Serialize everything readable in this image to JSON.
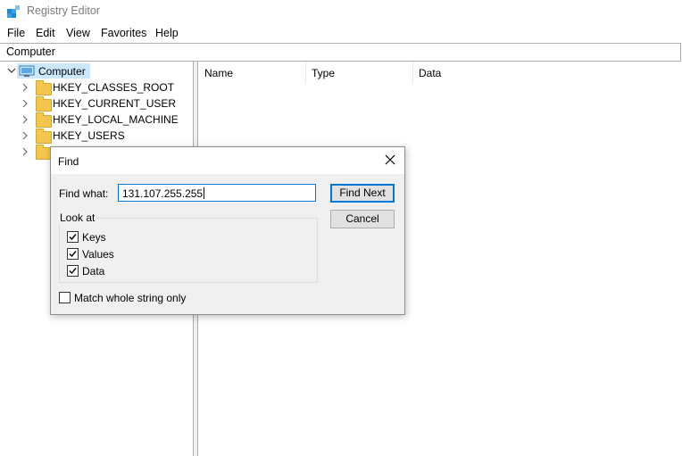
{
  "window": {
    "title": "Registry Editor"
  },
  "menu": [
    "File",
    "Edit",
    "View",
    "Favorites",
    "Help"
  ],
  "address": "Computer",
  "tree": {
    "root": "Computer",
    "keys": [
      "HKEY_CLASSES_ROOT",
      "HKEY_CURRENT_USER",
      "HKEY_LOCAL_MACHINE",
      "HKEY_USERS",
      ""
    ]
  },
  "columns": [
    "Name",
    "Type",
    "Data"
  ],
  "find_dialog": {
    "title": "Find",
    "find_what_label": "Find what:",
    "find_what_value": "131.107.255.255",
    "find_next_label": "Find Next",
    "cancel_label": "Cancel",
    "look_at_label": "Look at",
    "options": [
      {
        "label": "Keys",
        "checked": true
      },
      {
        "label": "Values",
        "checked": true
      },
      {
        "label": "Data",
        "checked": true
      }
    ],
    "match_whole_label": "Match whole string only",
    "match_whole_checked": false
  },
  "colors": {
    "accent": "#0078d7",
    "selection": "#cce8ff",
    "folder": "#f5c64d"
  }
}
